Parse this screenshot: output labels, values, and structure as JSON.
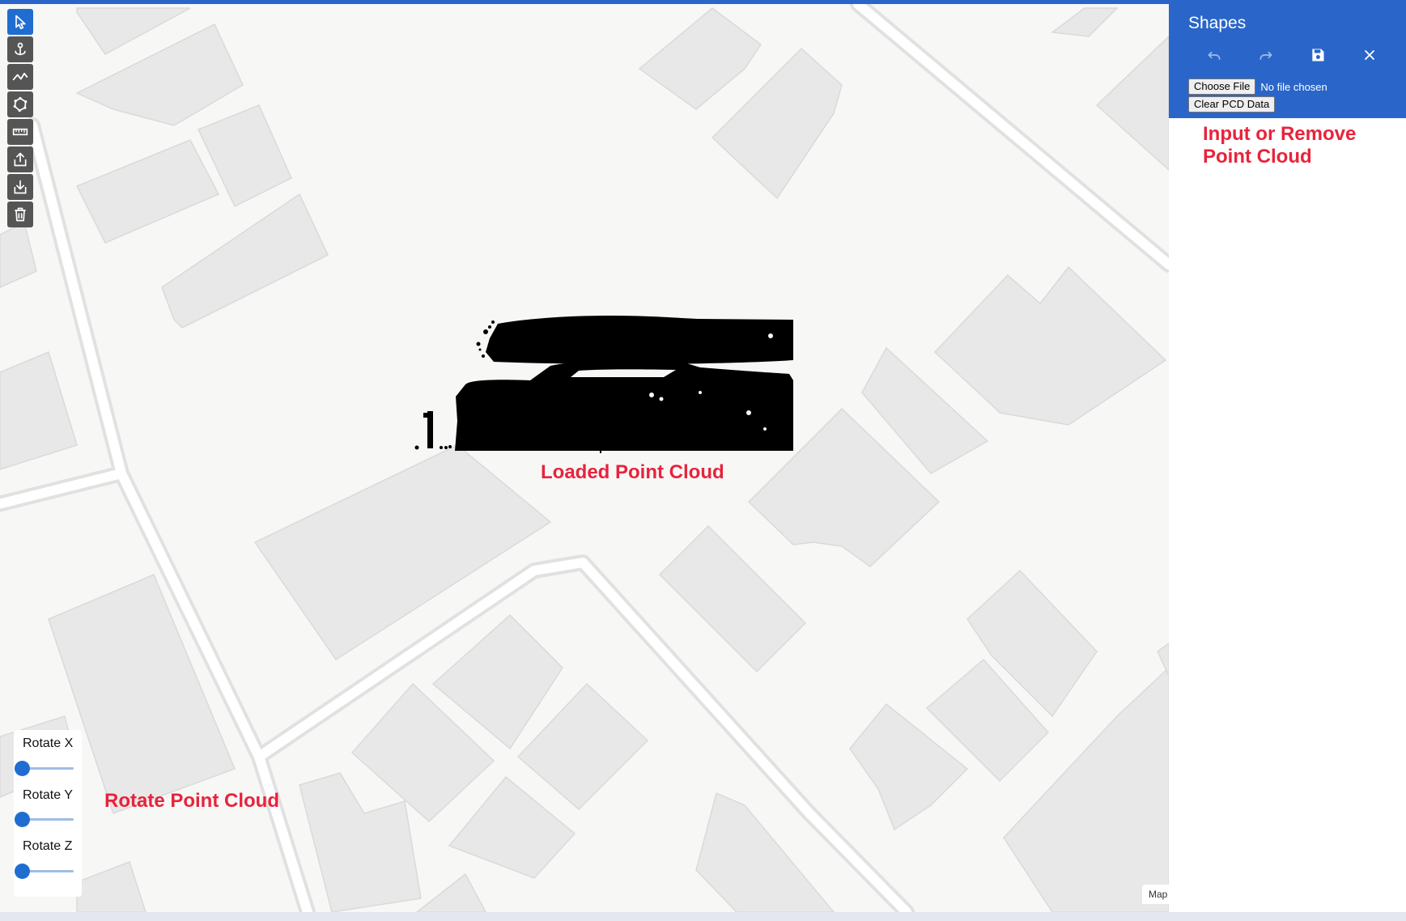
{
  "side_panel": {
    "title": "Shapes",
    "icons": [
      "undo-icon",
      "redo-icon",
      "save-icon",
      "close-icon"
    ],
    "choose_file_label": "Choose File",
    "file_status": "No file chosen",
    "clear_label": "Clear PCD Data"
  },
  "toolbar": {
    "tools": [
      "select-icon",
      "point-icon",
      "line-icon",
      "polygon-icon",
      "ruler-icon",
      "export-icon",
      "import-icon",
      "trash-icon"
    ],
    "active": "select-icon"
  },
  "rotation": {
    "x": {
      "label": "Rotate X",
      "value": 0
    },
    "y": {
      "label": "Rotate Y",
      "value": 0
    },
    "z": {
      "label": "Rotate Z",
      "value": 0
    }
  },
  "annotations": {
    "input_remove": "Input or Remove\nPoint Cloud",
    "loaded": "Loaded Point Cloud",
    "rotate": "Rotate Point Cloud"
  },
  "map": {
    "attribution": "Map"
  },
  "colors": {
    "accent": "#2a66c9",
    "annotation": "#e8233b",
    "building": "#e8e8e8",
    "road": "#ffffff"
  }
}
